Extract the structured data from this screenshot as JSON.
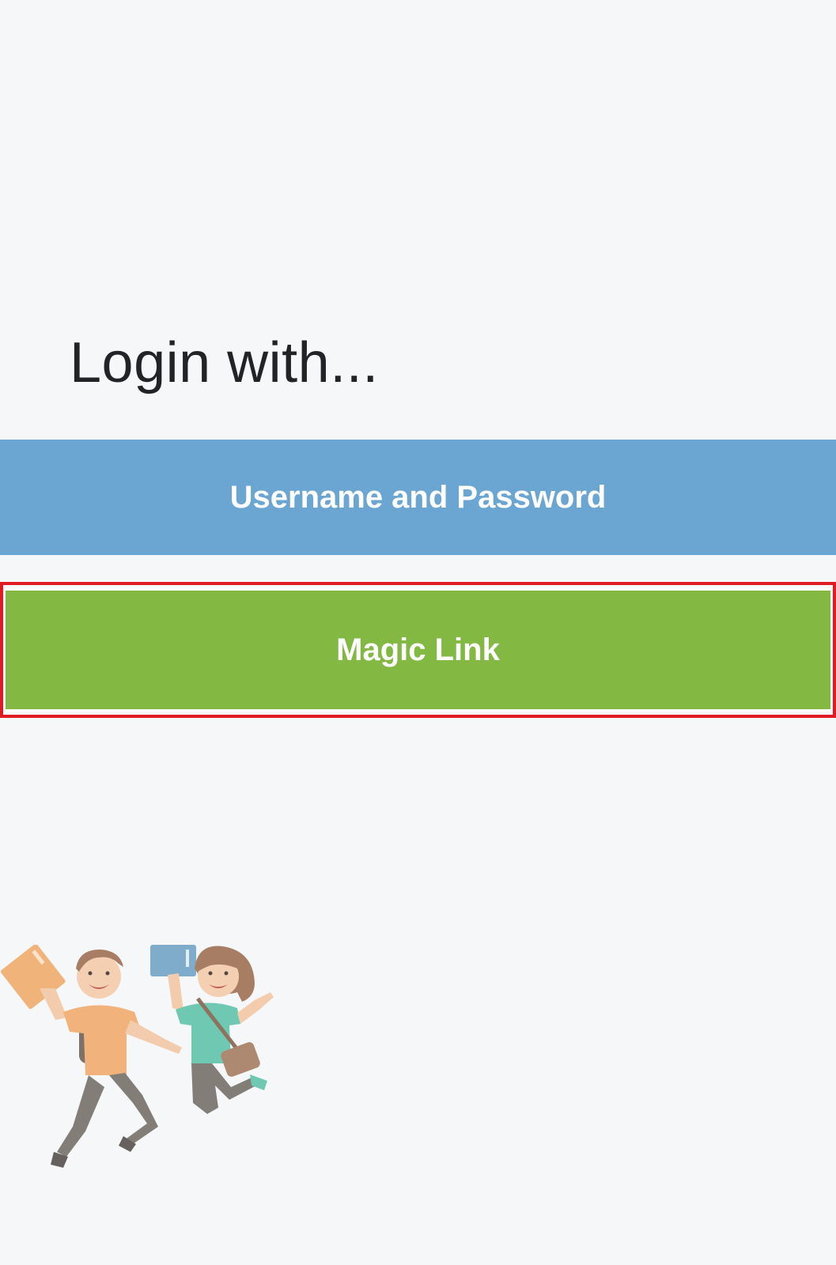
{
  "login": {
    "title": "Login with...",
    "username_password_label": "Username and Password",
    "magic_link_label": "Magic Link"
  },
  "colors": {
    "background": "#f6f7f9",
    "username_password_button": "#6ba5d2",
    "magic_link_button": "#83b943",
    "highlight_border": "#e01b24"
  },
  "illustration": {
    "icon": "jumping-students-illustration"
  }
}
